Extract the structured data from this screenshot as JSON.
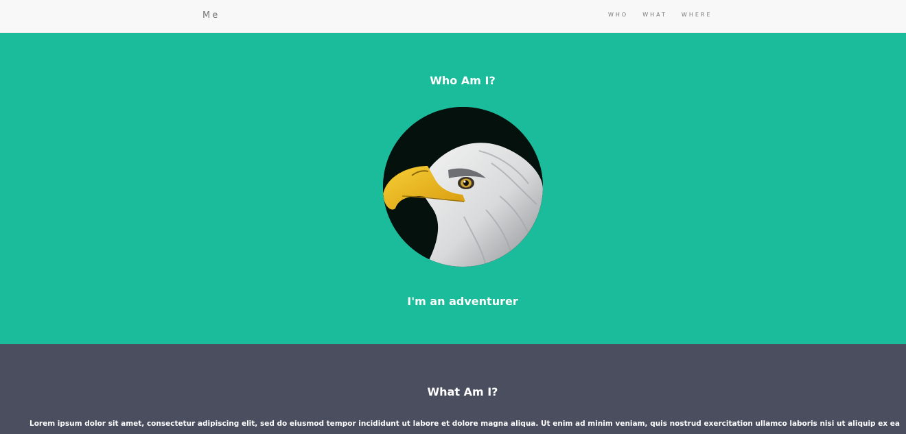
{
  "navbar": {
    "brand": "Me",
    "links": [
      "WHO",
      "WHAT",
      "WHERE"
    ]
  },
  "who": {
    "heading": "Who Am I?",
    "image_icon": "bald-eagle-portrait",
    "tagline": "I'm an adventurer"
  },
  "what": {
    "heading": "What Am I?",
    "paragraph": "Lorem ipsum dolor sit amet, consectetur adipiscing elit, sed do eiusmod tempor incididunt ut labore et dolore magna aliqua. Ut enim ad minim veniam, quis nostrud exercitation ullamco laboris nisi ut aliquip ex ea commodo consequat."
  },
  "colors": {
    "navbar_bg": "#f8f8f8",
    "who_bg": "#1bbc9b",
    "what_bg": "#4a4e5f",
    "text_light": "#ffffff",
    "nav_text": "#777777"
  }
}
